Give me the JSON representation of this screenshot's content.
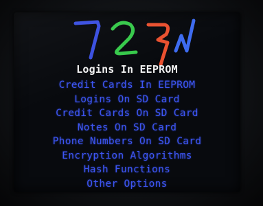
{
  "colors": {
    "logo_letter_1": "#3a4fe0",
    "logo_letter_2": "#36c94a",
    "logo_letter_3": "#e9502f",
    "logo_letter_4": "#3d6bf0",
    "title": "#f2f2f2",
    "menu_item": "#3d55f2",
    "screen_background": "#080a0e"
  },
  "logo": {
    "icon": "custom-glyph-logo"
  },
  "menu": {
    "title": "Logins In EEPROM",
    "items": [
      {
        "label": "Credit Cards In EEPROM"
      },
      {
        "label": "Logins On SD Card"
      },
      {
        "label": "Credit Cards On SD Card"
      },
      {
        "label": "Notes On SD Card"
      },
      {
        "label": "Phone Numbers On SD Card"
      },
      {
        "label": "Encryption Algorithms"
      },
      {
        "label": "Hash Functions"
      },
      {
        "label": "Other Options"
      }
    ]
  }
}
